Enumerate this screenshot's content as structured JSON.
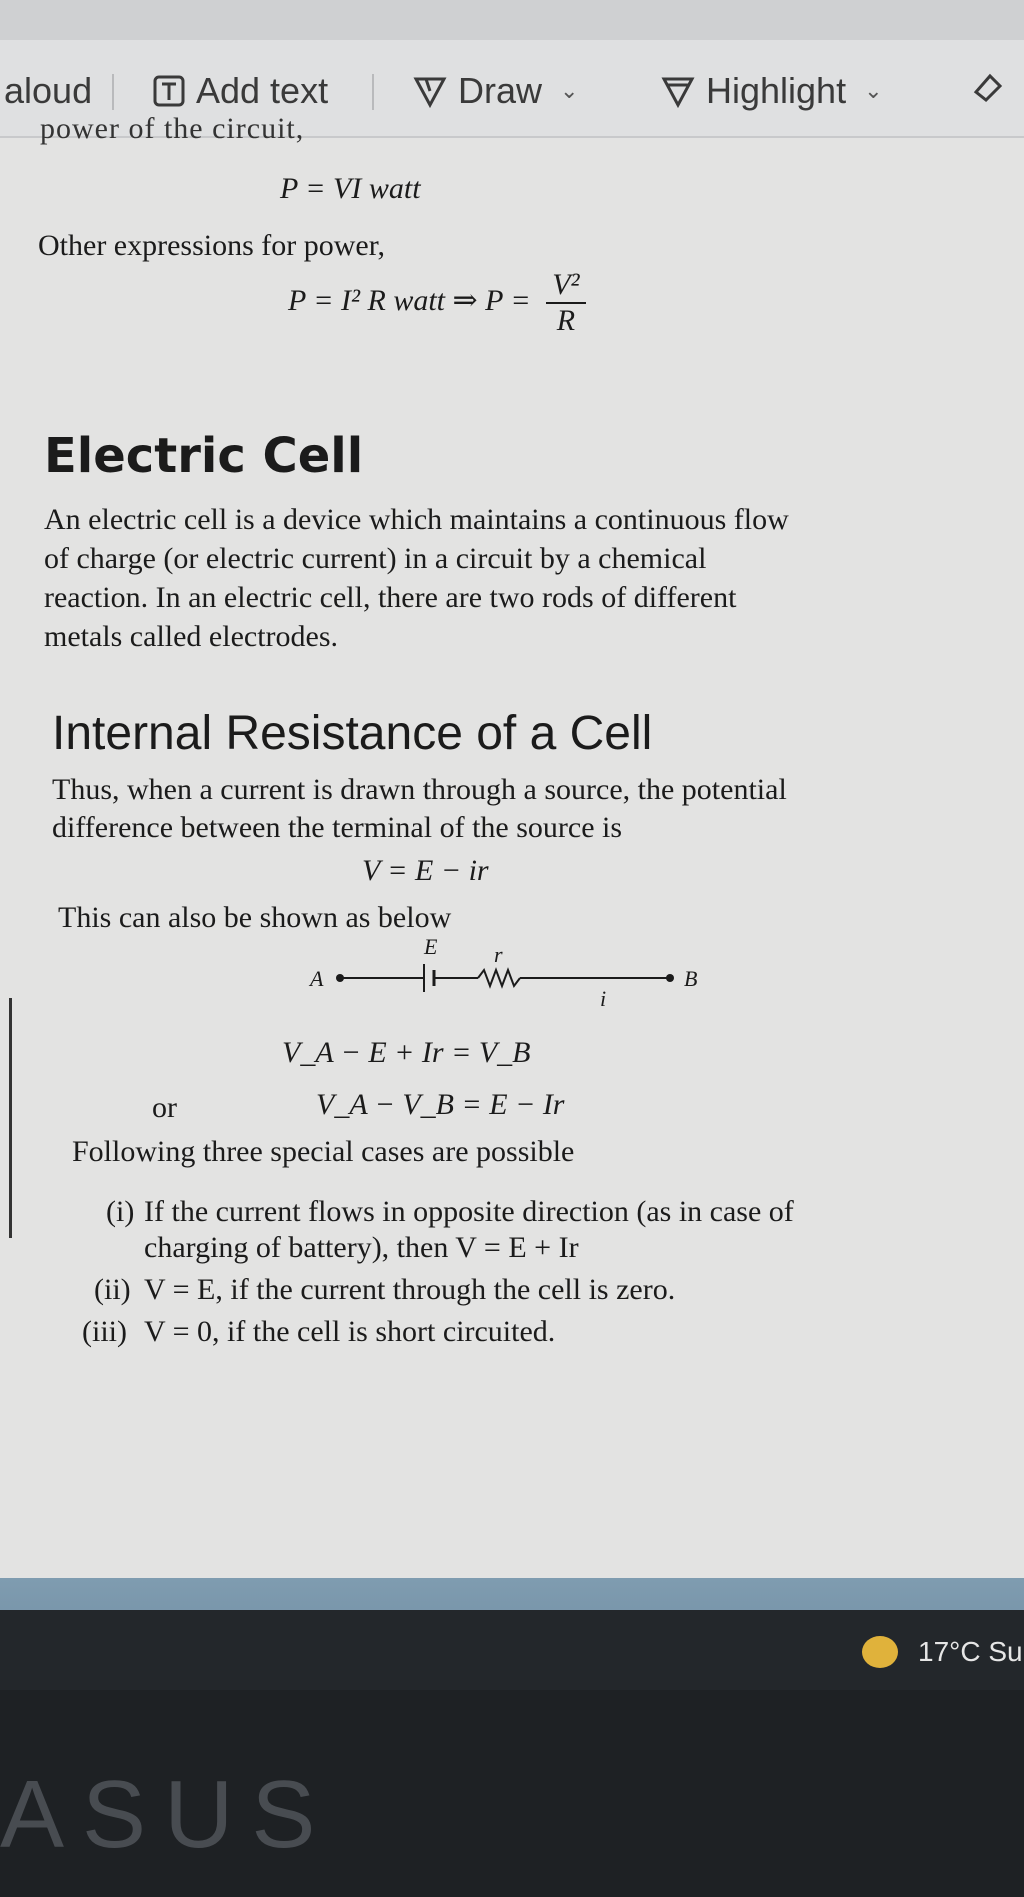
{
  "toolbar": {
    "read_aloud": "aloud",
    "add_text": "Add text",
    "draw": "Draw",
    "highlight": "Highlight"
  },
  "document": {
    "power_eq": "P = VI watt",
    "other_expr": "Other expressions for power,",
    "power_eq2_left": "P = I² R watt ⇒  P =",
    "power_eq2_num": "V²",
    "power_eq2_den": "R",
    "heading_cell": "Electric Cell",
    "cell_para_lines": [
      "An electric cell is a device which maintains a continuous flow",
      "of charge (or electric current) in a circuit by a chemical",
      "reaction. In an electric cell, there are two rods of different",
      "metals called electrodes."
    ],
    "heading_internal": "Internal Resistance of a Cell",
    "internal_para_lines": [
      "Thus, when a current is drawn through a source, the potential",
      "difference between the terminal of the source is"
    ],
    "v_eq": "V = E − ir",
    "shown_below": "This can also be shown as below",
    "circuit": {
      "a": "A",
      "b": "B",
      "e": "E",
      "r": "r",
      "i": "i"
    },
    "eq_va": "V_A − E + Ir = V_B",
    "or": "or",
    "eq_vavb": "V_A − V_B = E − Ir",
    "following": "Following three special cases are possible",
    "cases": [
      {
        "num": "(i)",
        "line1": "If the current flows in opposite direction (as in case of",
        "line2": "charging of battery), then V = E + Ir"
      },
      {
        "num": "(ii)",
        "line1": "V = E, if the current through the cell is zero."
      },
      {
        "num": "(iii)",
        "line1": "V = 0, if the cell is short circuited."
      }
    ]
  },
  "taskbar": {
    "weather": "17°C  Su"
  },
  "laptop_logo": "ASUS"
}
